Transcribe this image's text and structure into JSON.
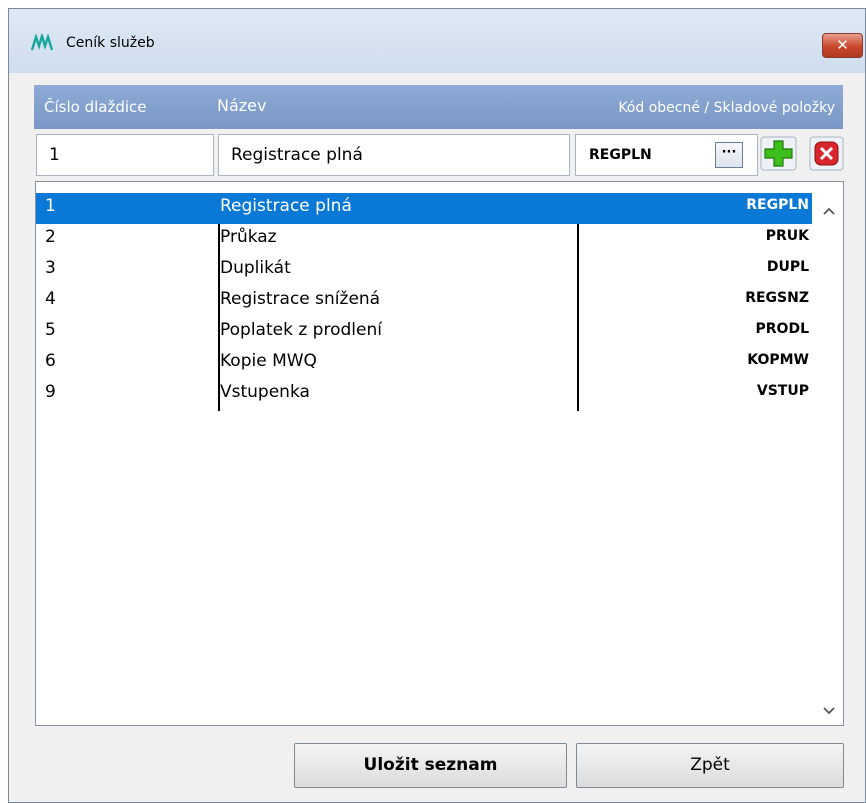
{
  "window": {
    "title": "Ceník služeb"
  },
  "header": {
    "col_number": "Číslo dlaždice",
    "col_name": "Název",
    "col_code": "Kód obecné / Skladové položky"
  },
  "editor": {
    "number_value": "1",
    "name_value": "Registrace plná",
    "code_value": "REGPLN",
    "browse_label": "···"
  },
  "list": {
    "rows": [
      {
        "number": "1",
        "name": "Registrace plná",
        "code": "REGPLN",
        "selected": true
      },
      {
        "number": "2",
        "name": "Průkaz",
        "code": "PRUK"
      },
      {
        "number": "3",
        "name": "Duplikát",
        "code": "DUPL"
      },
      {
        "number": "4",
        "name": "Registrace snížená",
        "code": "REGSNZ"
      },
      {
        "number": "5",
        "name": "Poplatek z prodlení",
        "code": "PRODL"
      },
      {
        "number": "6",
        "name": "Kopie MWQ",
        "code": "KOPMW"
      },
      {
        "number": "9",
        "name": "Vstupenka",
        "code": "VSTUP"
      }
    ]
  },
  "buttons": {
    "save_label": "Uložit seznam",
    "back_label": "Zpět"
  },
  "icons": {
    "app": "app-logo-icon",
    "close": "close-icon",
    "add": "plus-icon",
    "delete": "delete-icon",
    "scroll_up": "chevron-up-icon",
    "scroll_down": "chevron-down-icon"
  },
  "colors": {
    "header": "#8eaad5",
    "selection": "#0a78d7",
    "add": "#3cbf1d",
    "delete": "#d9262c"
  }
}
